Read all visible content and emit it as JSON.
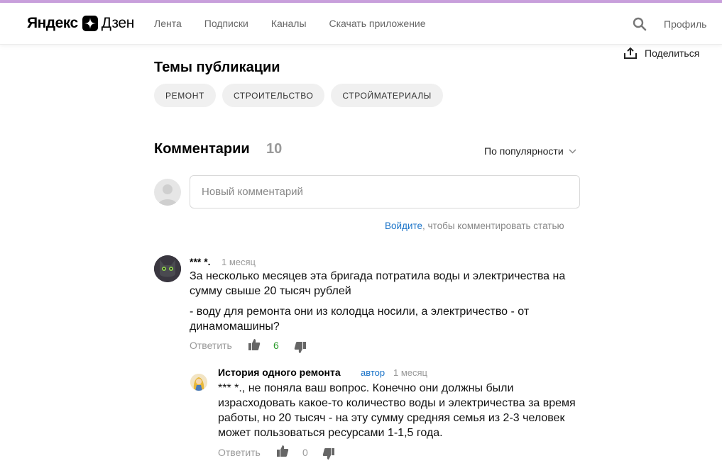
{
  "header": {
    "logo_part1": "Яндекс",
    "logo_part2": "Дзен",
    "nav": [
      {
        "label": "Лента"
      },
      {
        "label": "Подписки"
      },
      {
        "label": "Каналы"
      },
      {
        "label": "Скачать приложение"
      }
    ],
    "search_icon": "search-icon",
    "profile_label": "Профиль"
  },
  "share": {
    "label": "Поделиться",
    "icon": "share-icon"
  },
  "topics": {
    "title": "Темы публикации",
    "chips": [
      "РЕМОНТ",
      "СТРОИТЕЛЬСТВО",
      "СТРОЙМАТЕРИАЛЫ"
    ]
  },
  "comments": {
    "title": "Комментарии",
    "count": "10",
    "sort_label": "По популярности",
    "input_placeholder": "Новый комментарий",
    "login_link": "Войдите",
    "login_hint": ", чтобы комментировать статью",
    "items": [
      {
        "author": "*** *.",
        "time": "1 месяц",
        "text1": "За несколько месяцев эта бригада потратила воды и электричества на сумму свыше 20 тысяч рублей",
        "text2": "- воду для ремонта они из колодца носили, а электричество - от динамомашины?",
        "reply_label": "Ответить",
        "score": "6",
        "score_color": "#2a9a2a"
      },
      {
        "author": "История одного ремонта",
        "badge": "автор",
        "time": "1 месяц",
        "text1": "*** *., не поняла ваш вопрос. Конечно они должны были израсходовать какое-то количество воды и электричества за время работы, но 20 тысяч - на эту сумму средняя семья из 2-3 человек может пользоваться ресурсами 1-1,5 года.",
        "reply_label": "Ответить",
        "score": "0",
        "score_color": "#999999"
      }
    ]
  },
  "colors": {
    "accent_top": "#c9a0dc",
    "link": "#1a73c8"
  }
}
